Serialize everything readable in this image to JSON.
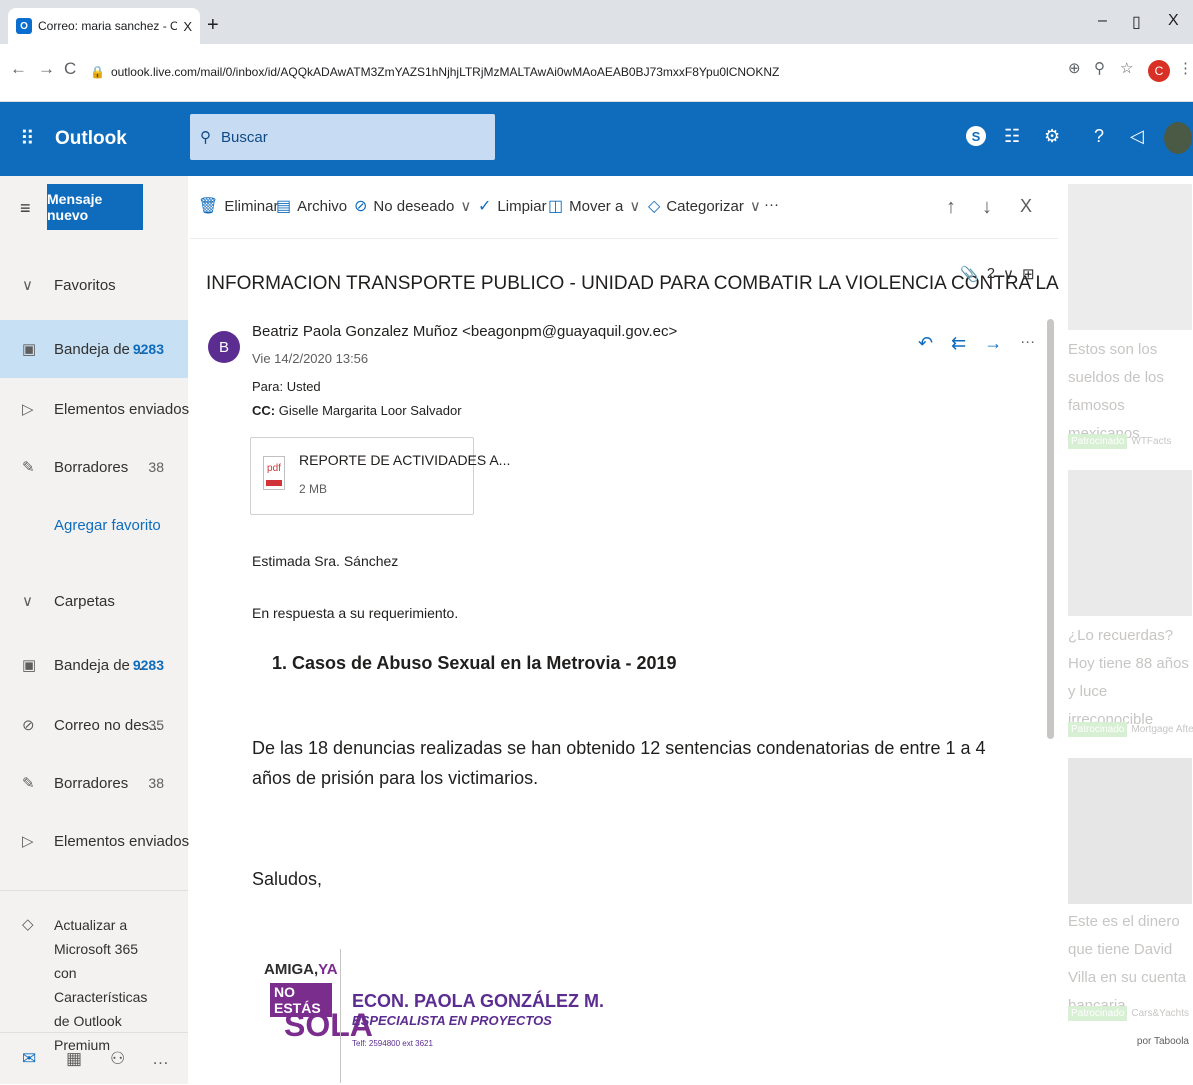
{
  "browser": {
    "tab_title": "Correo: maria sanchez - Outlook",
    "tab_close": "X",
    "new_tab": "+",
    "url": "outlook.live.com/mail/0/inbox/id/AQQkADAwATM3ZmYAZS1hNjhjLTRjMzMALTAwAi0wMAoAEAB0BJ73mxxF8Ypu0lCNOKNZ",
    "profile_initial": "C",
    "controls": {
      "minimize": "–",
      "maximize": "▯",
      "close": "X"
    }
  },
  "header": {
    "brand": "Outlook",
    "search_placeholder": "Buscar"
  },
  "leftnav": {
    "new_message": "Mensaje nuevo",
    "favorites_label": "Favoritos",
    "favorites": [
      {
        "label": "Bandeja de ...",
        "count": "9283"
      },
      {
        "label": "Elementos enviados",
        "count": ""
      },
      {
        "label": "Borradores",
        "count": "38"
      }
    ],
    "add_favorite": "Agregar favorito",
    "folders_label": "Carpetas",
    "folders": [
      {
        "label": "Bandeja de ...",
        "count": "9283"
      },
      {
        "label": "Correo no des...",
        "count": "35"
      },
      {
        "label": "Borradores",
        "count": "38"
      },
      {
        "label": "Elementos enviados",
        "count": ""
      }
    ],
    "upgrade_text": "Actualizar a Microsoft 365 con Características de Outlook Premium"
  },
  "toolbar": {
    "delete": "Eliminar",
    "archive": "Archivo",
    "junk": "No deseado",
    "sweep": "Limpiar",
    "move": "Mover a",
    "categorize": "Categorizar",
    "more": "···"
  },
  "message": {
    "subject": "INFORMACION TRANSPORTE PUBLICO - UNIDAD PARA COMBATIR LA VIOLENCIA CONTRA LA MUJER",
    "attachment_count": "2",
    "sender_initial": "B",
    "sender": "Beatriz Paola Gonzalez Muñoz <beagonpm@guayaquil.gov.ec>",
    "date": "Vie 14/2/2020 13:56",
    "to_label": "Para:",
    "to": "Usted",
    "cc_label": "CC:",
    "cc": "Giselle Margarita Loor Salvador",
    "attachment": {
      "name": "REPORTE DE ACTIVIDADES A...",
      "size": "2 MB",
      "type": "pdf"
    },
    "greeting": "Estimada Sra. Sánchez",
    "intro": "En respuesta a su requerimiento.",
    "heading": "1.  Casos de Abuso Sexual en la Metrovia - 2019",
    "paragraph": "De las 18 denuncias realizadas se han obtenido 12 sentencias condenatorias de entre 1 a 4 años de prisión para los victimarios.",
    "closing": "Saludos,",
    "signature": {
      "logo_line1": "AMIGA,",
      "logo_line1_accent": "YA",
      "logo_line2": "NO ESTÁS",
      "logo_line3": "SOLA",
      "name": "ECON. PAOLA GONZÁLEZ M.",
      "title": "ESPECIALISTA EN PROYECTOS",
      "phone": "Telf: 2594800 ext 3621"
    }
  },
  "ads": {
    "items": [
      {
        "title": "Estos son los sueldos de los famosos mexicanos",
        "tag": "Patrocinado",
        "source": "WTFacts"
      },
      {
        "title": "¿Lo recuerdas? Hoy tiene 88 años y luce irreconocible",
        "tag": "Patrocinado",
        "source": "Mortgage After ..."
      },
      {
        "title": "Este es el dinero que tiene David Villa en su cuenta bancaria",
        "tag": "Patrocinado",
        "source": "Cars&Yachts"
      }
    ],
    "provider": "por Taboola"
  }
}
